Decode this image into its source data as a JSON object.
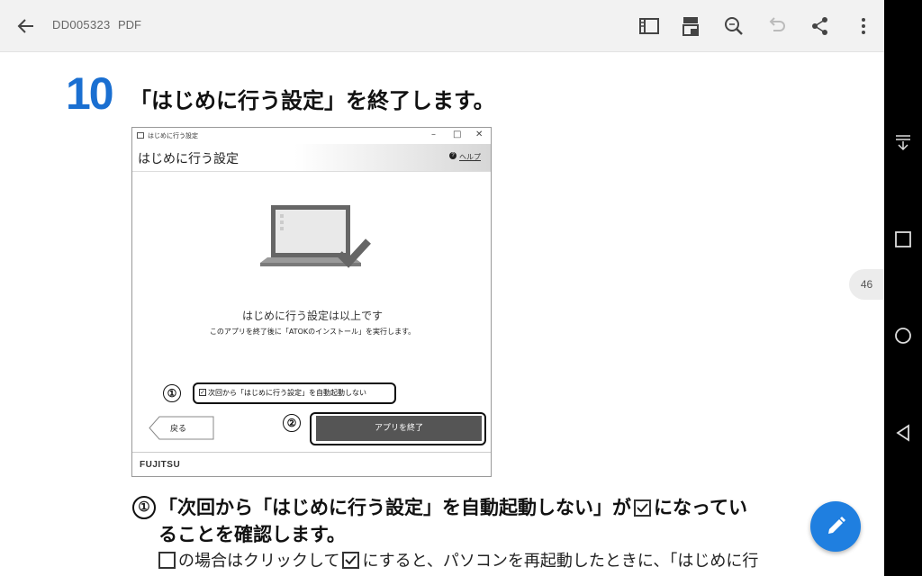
{
  "appbar": {
    "doc_name": "DD005323",
    "doc_type": "PDF",
    "icons": [
      "back-arrow-icon",
      "outline-icon",
      "page-layout-icon",
      "search-zoom-icon",
      "undo-icon",
      "share-icon",
      "more-vert-icon"
    ]
  },
  "nav": {
    "icons": [
      "download-icon",
      "overview-square-icon",
      "home-circle-icon",
      "back-triangle-icon"
    ]
  },
  "page_badge": "46",
  "step": {
    "number": "10",
    "title": "「はじめに行う設定」を終了します。"
  },
  "dialog": {
    "window_title": "はじめに行う設定",
    "controls": [
      "–",
      "□",
      "✕"
    ],
    "heading": "はじめに行う設定",
    "help": "ヘルプ",
    "done_text": "はじめに行う設定は以上です",
    "note": "このアプリを終了後に「ATOKのインストール」を実行します。",
    "marker1": "①",
    "checkbox_label": "次回から「はじめに行う設定」を自動起動しない",
    "checkbox_checked": true,
    "back_button": "戻る",
    "marker2": "②",
    "quit_button": "アプリを終了",
    "brand": "FUJITSU"
  },
  "instruction": {
    "marker": "①",
    "line1_a": "「次回から「はじめに行う設定」を自動起動しない」が",
    "line1_b": "になってい",
    "line2": "ることを確認します。",
    "line3_a": "の場合はクリックして",
    "line3_b": "にすると、パソコンを再起動したときに、「はじめに行"
  },
  "colors": {
    "accent": "#1a6fd1",
    "fab": "#1f7fe0",
    "quit_button": "#555555"
  }
}
